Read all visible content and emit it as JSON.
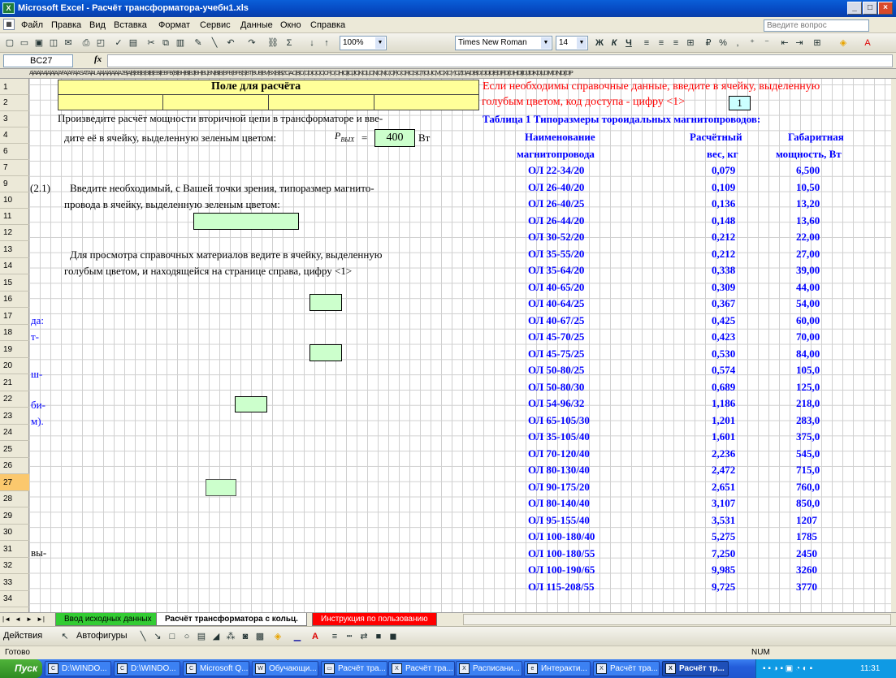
{
  "window": {
    "title": "Microsoft Excel - Расчёт трансформатора-учебн1.xls",
    "app_icon": "X",
    "controls": [
      "_",
      "□",
      "×"
    ]
  },
  "menu": {
    "items": [
      "Файл",
      "Правка",
      "Вид",
      "Вставка",
      "Формат",
      "Сервис",
      "Данные",
      "Окно",
      "Справка"
    ],
    "ask_placeholder": "Введите вопрос"
  },
  "toolbar": {
    "zoom": "100%",
    "font": "Times New Roman",
    "font_size": "14",
    "bold": "Ж",
    "italic": "К",
    "underline": "Ч"
  },
  "formula_bar": {
    "name_box": "BC27",
    "fx": "fx",
    "content": ""
  },
  "rows": [
    "1",
    "2",
    "3",
    "4",
    "6",
    "7",
    "9",
    "10",
    "11",
    "12",
    "13",
    "14",
    "15",
    "16",
    "17",
    "18",
    "19",
    "20",
    "21",
    "22",
    "23",
    "24",
    "25",
    "26",
    "27",
    "28",
    "29",
    "30",
    "31",
    "32",
    "33",
    "34"
  ],
  "selected_row": "27",
  "sheet": {
    "header_calc": "Поле для расчёта",
    "info_line1": "Если необходимы справочные данные, введите в ячейку, выделенную",
    "info_line2": "голубым цветом, код доступа - цифру <1>",
    "access_code": "1",
    "task_line1": "Произведите расчёт мощности вторичной цепи в трансформаторе и вве-",
    "task_line2": "дите её в ячейку, выделенную зеленым цветом:",
    "p_label": "P",
    "p_sub": "ВЫХ",
    "p_eq": "=",
    "p_value": "400",
    "p_unit": "Вт",
    "step_number": "(2.1)",
    "step_text1": "Введите необходимый, с Вашей точки зрения, типоразмер магнито-",
    "step_text2": "провода в ячейку, выделенную зеленым цветом:",
    "ref_text1": "Для просмотра  справочных материалов  ведите в ячейку,  выделенную",
    "ref_text2": "голубым цветом, и находящейся на странице справа, цифру <1>",
    "left_fragments": [
      "да:",
      "т-",
      "ш-",
      "би-",
      "м).",
      "вы-"
    ]
  },
  "table": {
    "title": "Таблица 1  Типоразмеры тороидальных магнитопроводов:",
    "headers": [
      [
        "Наименование",
        "магнитопровода"
      ],
      [
        "Расчётный",
        "вес, кг"
      ],
      [
        "Габаритная",
        "мощность, Вт"
      ]
    ],
    "rows": [
      [
        "ОЛ 22-34/20",
        "0,079",
        "6,500"
      ],
      [
        "ОЛ 26-40/20",
        "0,109",
        "10,50"
      ],
      [
        "ОЛ 26-40/25",
        "0,136",
        "13,20"
      ],
      [
        "ОЛ 26-44/20",
        "0,148",
        "13,60"
      ],
      [
        "ОЛ 30-52/20",
        "0,212",
        "22,00"
      ],
      [
        "ОЛ 35-55/20",
        "0,212",
        "27,00"
      ],
      [
        "ОЛ 35-64/20",
        "0,338",
        "39,00"
      ],
      [
        "ОЛ 40-65/20",
        "0,309",
        "44,00"
      ],
      [
        "ОЛ 40-64/25",
        "0,367",
        "54,00"
      ],
      [
        "ОЛ 40-67/25",
        "0,425",
        "60,00"
      ],
      [
        "ОЛ 45-70/25",
        "0,423",
        "70,00"
      ],
      [
        "ОЛ 45-75/25",
        "0,530",
        "84,00"
      ],
      [
        "ОЛ 50-80/25",
        "0,574",
        "105,0"
      ],
      [
        "ОЛ 50-80/30",
        "0,689",
        "125,0"
      ],
      [
        "ОЛ 54-96/32",
        "1,186",
        "218,0"
      ],
      [
        "ОЛ 65-105/30",
        "1,201",
        "283,0"
      ],
      [
        "ОЛ 35-105/40",
        "1,601",
        "375,0"
      ],
      [
        "ОЛ 70-120/40",
        "2,236",
        "545,0"
      ],
      [
        "ОЛ 80-130/40",
        "2,472",
        "715,0"
      ],
      [
        "ОЛ 90-175/20",
        "2,651",
        "760,0"
      ],
      [
        "ОЛ 80-140/40",
        "3,107",
        "850,0"
      ],
      [
        "ОЛ 95-155/40",
        "3,531",
        "1207"
      ],
      [
        "ОЛ 100-180/40",
        "5,275",
        "1785"
      ],
      [
        "ОЛ 100-180/55",
        "7,250",
        "2450"
      ],
      [
        "ОЛ 100-190/65",
        "9,985",
        "3260"
      ],
      [
        "ОЛ 115-208/55",
        "9,725",
        "3770"
      ]
    ]
  },
  "sheet_tabs": [
    "Ввод исходных данных",
    "Расчёт трансформатора с кольц.",
    "Инструкция по пользованию"
  ],
  "drawing": {
    "actions": "Действия",
    "autoshapes": "Автофигуры"
  },
  "status": {
    "left": "Готово",
    "num": "NUM"
  },
  "taskbar": {
    "start": "Пуск",
    "tasks": [
      "D:\\WINDO...",
      "D:\\WINDO...",
      "Microsoft Q...",
      "Обучающи...",
      "Расчёт тра...",
      "Расчёт тра...",
      "Расписани...",
      "Интеракти...",
      "Расчёт тра...",
      "Расчёт тр..."
    ],
    "clock": "11:31"
  },
  "colors": {
    "accent_blue": "#0000ff",
    "header_yellow": "#ffff99",
    "input_green": "#ccffcc",
    "red_text": "#ff0000"
  }
}
